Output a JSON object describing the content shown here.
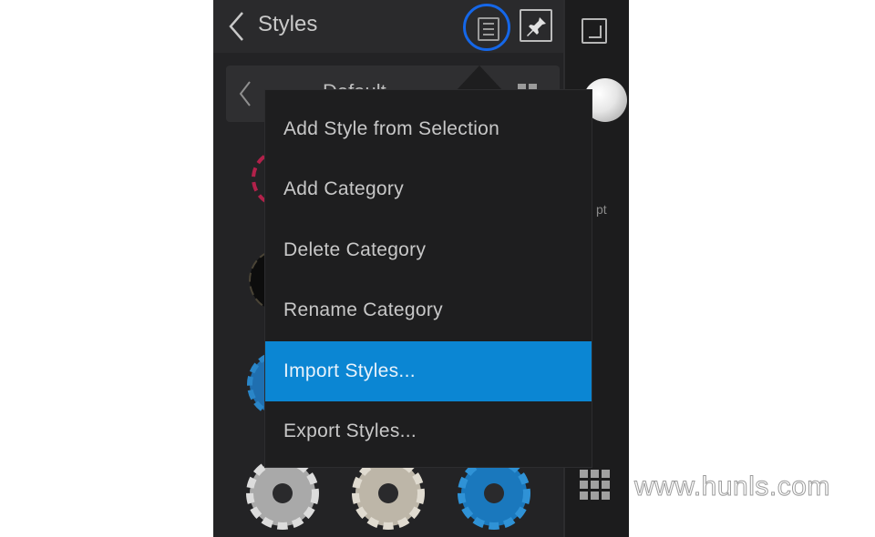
{
  "header": {
    "title": "Styles",
    "back_icon": "chevron-left-icon",
    "menu_icon": "hamburger-menu-icon",
    "pin_icon": "pushpin-icon",
    "menu_highlight_color": "#1567e8"
  },
  "category": {
    "name": "Default",
    "back_icon": "chevron-left-icon",
    "view_icon": "grid-view-icon"
  },
  "menu": {
    "items": [
      {
        "label": "Add Style from Selection"
      },
      {
        "label": "Add Category"
      },
      {
        "label": "Delete Category"
      },
      {
        "label": "Rename Category"
      },
      {
        "label": "Import Styles...",
        "active": true
      },
      {
        "label": "Export Styles..."
      }
    ],
    "active_color": "#0b86d3"
  },
  "styles": [
    {
      "name": "red-outline-gear-icon",
      "color": "#b2214a"
    },
    {
      "name": "black-gear-icon",
      "color": "#111111"
    },
    {
      "name": "blue-gear-icon",
      "color": "#1f6fb0"
    },
    {
      "name": "silver-gear-icon",
      "color": "#a9a9a9"
    },
    {
      "name": "textured-silver-gear-icon",
      "color": "#bdb6a8"
    },
    {
      "name": "blue-textured-gear-icon",
      "color": "#1a78bd"
    }
  ],
  "toolbar": {
    "expand_icon": "expand-icon",
    "sphere_icon": "sphere-icon",
    "pt_label": "pt",
    "grid_icon": "grid-icon"
  },
  "watermark": "www.hunls.com"
}
